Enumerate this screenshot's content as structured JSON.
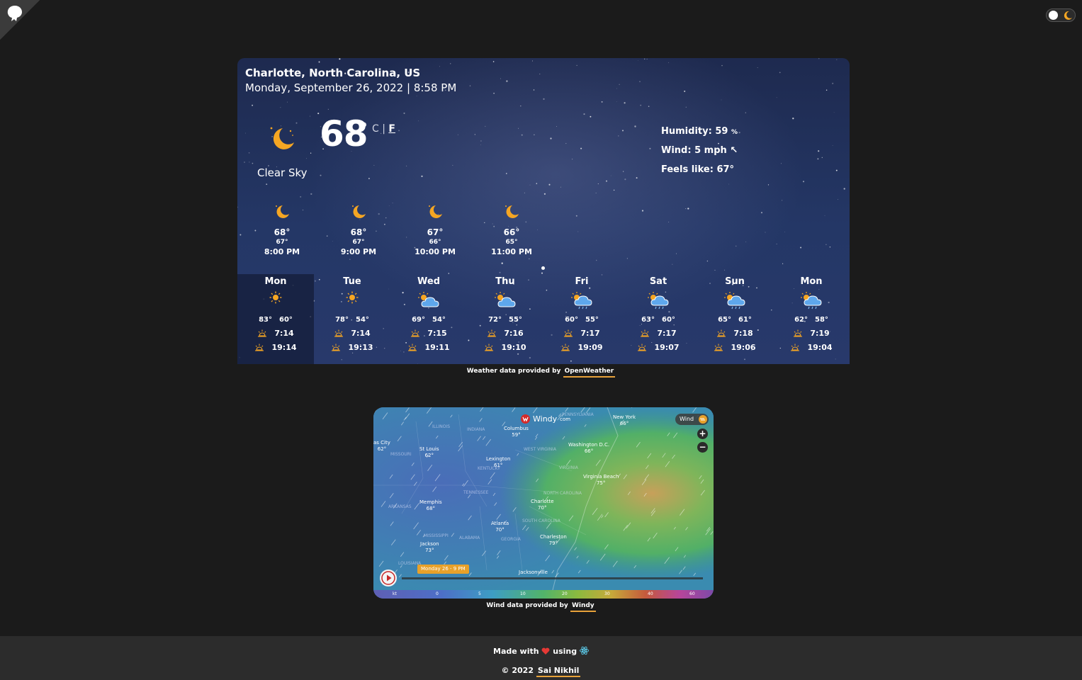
{
  "header": {
    "logo_icon": "octocat-corner-icon",
    "theme_toggle_icon": "moon-icon"
  },
  "current": {
    "location": "Charlotte, North Carolina, US",
    "datetime": "Monday, September 26, 2022 | 8:58 PM",
    "icon": "crescent-moon-icon",
    "temperature": "68",
    "degree": "°",
    "unit_c": "C",
    "unit_sep": "|",
    "unit_f": "F",
    "description": "Clear Sky",
    "humidity_label": "Humidity:",
    "humidity_value": "59",
    "humidity_unit": "%",
    "wind_label": "Wind:",
    "wind_value": "5 mph",
    "wind_arrow": "↖",
    "feels_label": "Feels like:",
    "feels_value": "67°"
  },
  "hourly": [
    {
      "temp": "68°",
      "low": "67°",
      "time": "8:00 PM",
      "icon": "crescent-moon-icon"
    },
    {
      "temp": "68°",
      "low": "67°",
      "time": "9:00 PM",
      "icon": "crescent-moon-icon"
    },
    {
      "temp": "67°",
      "low": "66°",
      "time": "10:00 PM",
      "icon": "crescent-moon-icon"
    },
    {
      "temp": "66°",
      "low": "65°",
      "time": "11:00 PM",
      "icon": "crescent-moon-icon"
    }
  ],
  "daily": [
    {
      "day": "Mon",
      "high": "83°",
      "low": "60°",
      "sunrise": "7:14",
      "sunset": "19:14",
      "icon": "sun-icon"
    },
    {
      "day": "Tue",
      "high": "78°",
      "low": "54°",
      "sunrise": "7:14",
      "sunset": "19:13",
      "icon": "sun-icon"
    },
    {
      "day": "Wed",
      "high": "69°",
      "low": "54°",
      "sunrise": "7:15",
      "sunset": "19:11",
      "icon": "partly-cloudy-icon"
    },
    {
      "day": "Thu",
      "high": "72°",
      "low": "55°",
      "sunrise": "7:16",
      "sunset": "19:10",
      "icon": "partly-cloudy-icon"
    },
    {
      "day": "Fri",
      "high": "60°",
      "low": "55°",
      "sunrise": "7:17",
      "sunset": "19:09",
      "icon": "rain-cloud-icon"
    },
    {
      "day": "Sat",
      "high": "63°",
      "low": "60°",
      "sunrise": "7:17",
      "sunset": "19:07",
      "icon": "rain-cloud-icon"
    },
    {
      "day": "Sun",
      "high": "65°",
      "low": "61°",
      "sunrise": "7:18",
      "sunset": "19:06",
      "icon": "rain-cloud-icon"
    },
    {
      "day": "Mon",
      "high": "62°",
      "low": "58°",
      "sunrise": "7:19",
      "sunset": "19:04",
      "icon": "rain-cloud-icon"
    }
  ],
  "weather_credit": {
    "text": "Weather data provided by",
    "link": "OpenWeather"
  },
  "map": {
    "brand": "Windy",
    "brand_suffix": "com",
    "layer_label": "Wind",
    "timeline_label": "Monday 26 - 9 PM",
    "scale_unit": "kt",
    "scale_ticks": [
      "0",
      "5",
      "10",
      "20",
      "30",
      "40",
      "60"
    ],
    "cities": [
      {
        "name": "Columbus",
        "temp": "59°"
      },
      {
        "name": "New York",
        "temp": "66°"
      },
      {
        "name": "St Louis",
        "temp": "62°"
      },
      {
        "name": "Washington D.C.",
        "temp": "66°"
      },
      {
        "name": "Lexington",
        "temp": "61°"
      },
      {
        "name": "Virginia Beach",
        "temp": "75°"
      },
      {
        "name": "Memphis",
        "temp": "68°"
      },
      {
        "name": "Charlotte",
        "temp": "70°"
      },
      {
        "name": "Atlanta",
        "temp": "70°"
      },
      {
        "name": "Charleston",
        "temp": "79°"
      },
      {
        "name": "Jackson",
        "temp": "73°"
      },
      {
        "name": "Jacksonville",
        "temp": ""
      },
      {
        "name": "as City",
        "temp": "62°"
      }
    ],
    "states": [
      "ILLINOIS",
      "INDIANA",
      "MISSOURI",
      "WEST VIRGINIA",
      "KENTUCKY",
      "VIRGINIA",
      "TENNESSEE",
      "NORTH CAROLINA",
      "ARKANSAS",
      "SOUTH CAROLINA",
      "MISSISSIPPI",
      "ALABAMA",
      "GEORGIA",
      "LOUISIANA",
      "PENNSYLVANIA"
    ]
  },
  "wind_credit": {
    "text": "Wind data provided by",
    "link": "Windy"
  },
  "footer": {
    "made_with": "Made with",
    "using": "using",
    "copyright": "© 2022",
    "author": "Sai Nikhil"
  }
}
